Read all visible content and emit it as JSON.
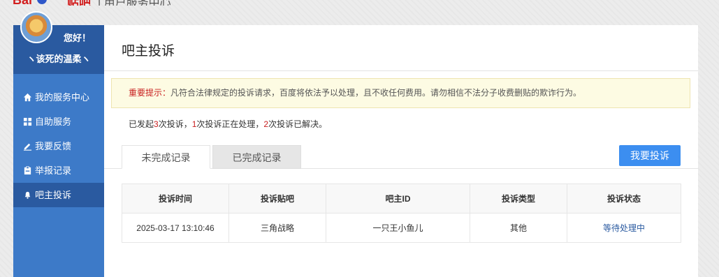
{
  "brand": {
    "logo": "Bai",
    "tieba": "贴吧",
    "sub": "| 用户服务中心"
  },
  "user": {
    "greeting": "您好！",
    "name": "ヽ该死的温柔ヽ"
  },
  "menu": [
    {
      "icon": "home-icon",
      "label": "我的服务中心"
    },
    {
      "icon": "grid-icon",
      "label": "自助服务"
    },
    {
      "icon": "pencil-icon",
      "label": "我要反馈"
    },
    {
      "icon": "clipboard-icon",
      "label": "举报记录"
    },
    {
      "icon": "bell-icon",
      "label": "吧主投诉"
    }
  ],
  "page": {
    "title": "吧主投诉",
    "notice_key": "重要提示：",
    "notice_text": "凡符合法律规定的投诉请求，百度将依法予以处理，且不收任何费用。请勿相信不法分子收费删贴的欺诈行为。",
    "stats": {
      "p1": "已发起",
      "n1": "3",
      "p2": "次投诉，",
      "n2": "1",
      "p3": "次投诉正在处理，",
      "n3": "2",
      "p4": "次投诉已解决。"
    },
    "tabs": [
      "未完成记录",
      "已完成记录"
    ],
    "button": "我要投诉"
  },
  "table": {
    "headers": [
      "投诉时间",
      "投诉贴吧",
      "吧主ID",
      "投诉类型",
      "投诉状态"
    ],
    "rows": [
      [
        "2025-03-17 13:10:46",
        "三角战略",
        "一只王小鱼儿",
        "其他",
        "等待处理中"
      ]
    ]
  },
  "colors": {
    "sidebar": "#3d7ac8",
    "sidebar_active": "#2a5aa0",
    "accent": "#3c8ef0",
    "warn": "#c81e1e"
  }
}
